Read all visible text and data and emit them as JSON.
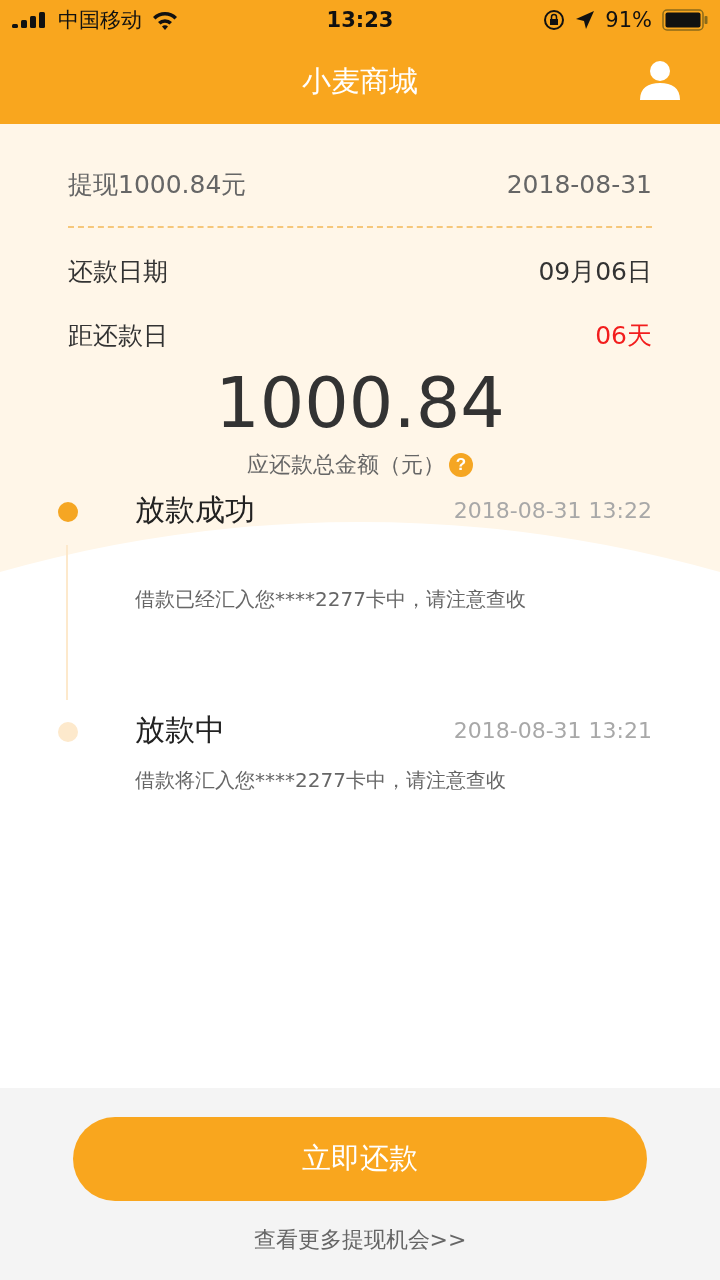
{
  "status_bar": {
    "carrier": "中国移动",
    "time": "13:23",
    "battery": "91%"
  },
  "nav": {
    "title": "小麦商城"
  },
  "summary": {
    "withdrawal": "提现1000.84元",
    "withdrawal_date": "2018-08-31",
    "rows": [
      {
        "label": "还款日期",
        "value": "09月06日",
        "highlight": false
      },
      {
        "label": "距还款日",
        "value": "06天",
        "highlight": true
      }
    ],
    "amount": "1000.84",
    "amount_label": "应还款总金额（元）",
    "help": "?"
  },
  "timeline": [
    {
      "title": "放款成功",
      "time": "2018-08-31 13:22",
      "description": "借款已经汇入您****2277卡中，请注意查收",
      "active": true
    },
    {
      "title": "放款中",
      "time": "2018-08-31 13:21",
      "description": "借款将汇入您****2277卡中，请注意查收",
      "active": false
    }
  ],
  "footer": {
    "button": "立即还款",
    "link": "查看更多提现机会>>"
  }
}
